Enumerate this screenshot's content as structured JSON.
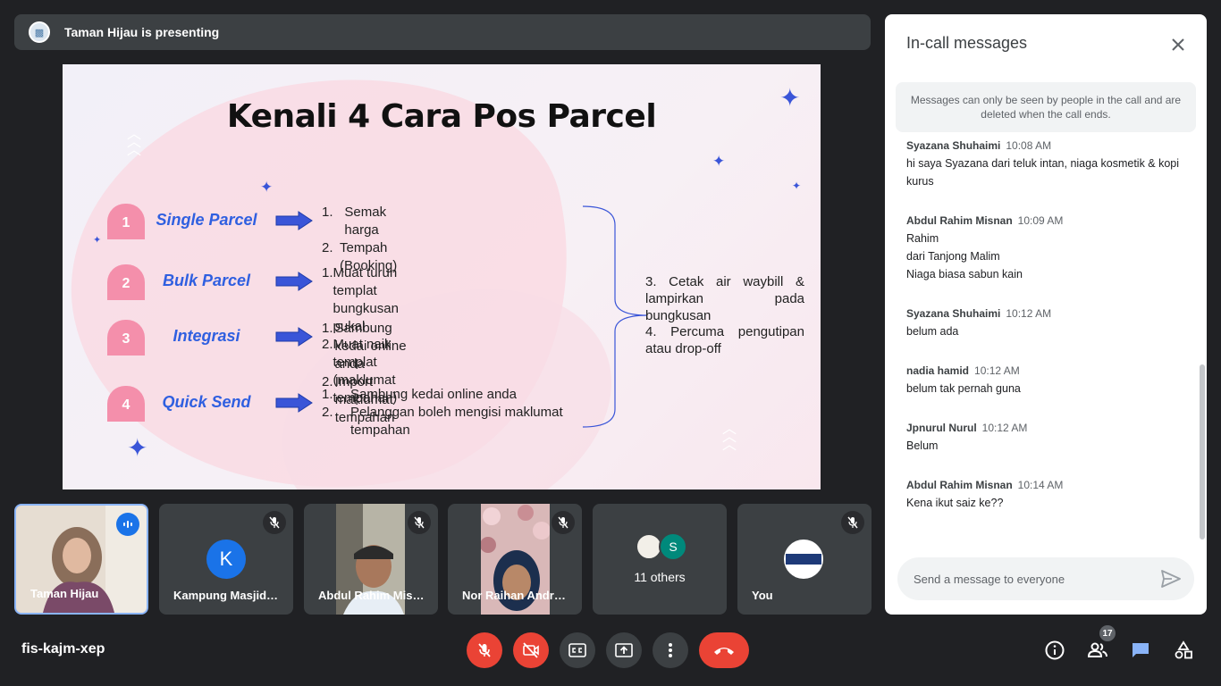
{
  "presenting_bar": {
    "text": "Taman Hijau is presenting"
  },
  "slide": {
    "title": "Kenali 4 Cara Pos Parcel",
    "methods": [
      {
        "number": "1",
        "name": "Single Parcel",
        "steps": [
          {
            "n": "1.",
            "text": "Semak harga"
          },
          {
            "n": "2.",
            "text": "Tempah (Booking)"
          }
        ]
      },
      {
        "number": "2",
        "name": "Bulk Parcel",
        "steps": [
          {
            "n": "1.",
            "text": "Muat turun templat bungkusan pukal"
          },
          {
            "n": "2.",
            "text": "Muat naik templat (maklumat tempahan)"
          }
        ]
      },
      {
        "number": "3",
        "name": "Integrasi",
        "steps": [
          {
            "n": "1.",
            "text": "Sambung kedai online anda"
          },
          {
            "n": "2.",
            "text": "Import maklumat tempahan"
          }
        ]
      },
      {
        "number": "4",
        "name": "Quick Send",
        "steps": [
          {
            "n": "1.",
            "text": "Sambung kedai online anda"
          },
          {
            "n": "2.",
            "text": "Pelanggan boleh mengisi maklumat tempahan"
          }
        ]
      }
    ],
    "side_notes": [
      "3. Cetak air waybill & lampirkan pada bungkusan",
      "4. Percuma pengutipan atau drop-off"
    ]
  },
  "participants": [
    {
      "name": "Taman Hijau",
      "state": "speaking"
    },
    {
      "name": "Kampung Masjid Tinggi",
      "initial": "K",
      "state": "muted"
    },
    {
      "name": "Abdul Rahim Misnan",
      "state": "muted"
    },
    {
      "name": "Nor Raihan Andrew",
      "state": "muted"
    },
    {
      "name": "11 others",
      "initial": "S"
    },
    {
      "name": "You",
      "state": "muted"
    }
  ],
  "chat": {
    "title": "In-call messages",
    "notice": "Messages can only be seen by people in the call and are deleted when the call ends.",
    "messages": [
      {
        "sender": "Syazana Shuhaimi",
        "time": "10:08 AM",
        "text": "hi saya Syazana dari teluk intan, niaga kosmetik & kopi kurus"
      },
      {
        "sender": "Abdul Rahim Misnan",
        "time": "10:09 AM",
        "lines": [
          "Rahim",
          "dari Tanjong Malim",
          "Niaga biasa sabun kain"
        ]
      },
      {
        "sender": "Syazana Shuhaimi",
        "time": "10:12 AM",
        "text": "belum ada"
      },
      {
        "sender": "nadia hamid",
        "time": "10:12 AM",
        "text": "belum tak pernah guna"
      },
      {
        "sender": "Jpnurul Nurul",
        "time": "10:12 AM",
        "text": "Belum"
      },
      {
        "sender": "Abdul Rahim Misnan",
        "time": "10:14 AM",
        "text": "Kena ikut saiz ke??"
      }
    ],
    "input_placeholder": "Send a message to everyone"
  },
  "bottom_bar": {
    "meeting_code": "fis-kajm-xep",
    "people_count": "17"
  },
  "colors": {
    "background": "#202124",
    "tile": "#3c4043",
    "danger": "#ea4335",
    "accent": "#1a73e8",
    "slide_blue": "#2f5fe0",
    "slide_pink": "#f48fab"
  }
}
